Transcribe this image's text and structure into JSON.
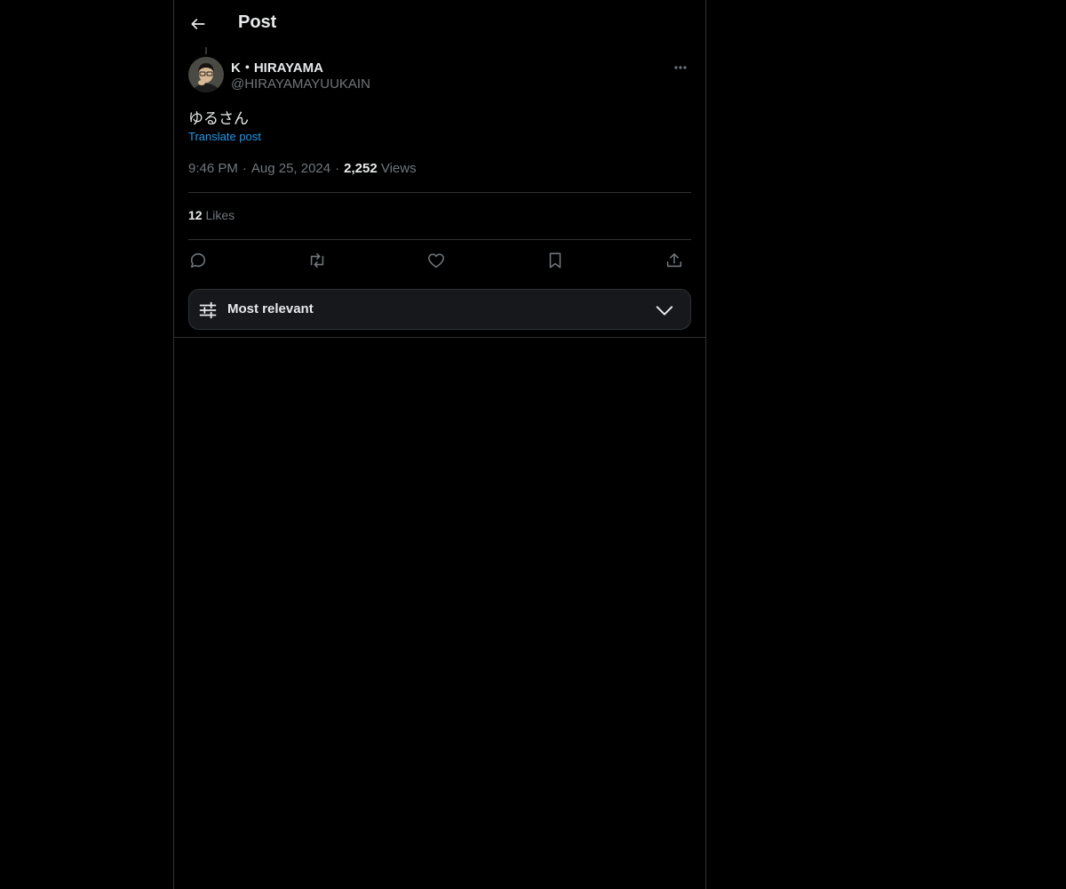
{
  "header": {
    "title": "Post",
    "back_icon": "arrow-left-icon"
  },
  "post": {
    "author": {
      "name": "K・HIRAYAMA",
      "handle": "@HIRAYAMAYUUKAIN"
    },
    "text": "ゆるさん",
    "translate_label": "Translate post",
    "time": "9:46 PM",
    "separator": "·",
    "date": "Aug 25, 2024",
    "views_count": "2,252",
    "views_label": "Views",
    "likes_count": "12",
    "likes_label": "Likes"
  },
  "actions": {
    "icons": [
      "reply-icon",
      "repost-icon",
      "like-icon",
      "bookmark-icon",
      "share-icon"
    ]
  },
  "sort": {
    "label": "Most relevant",
    "icon": "sliders-icon"
  },
  "colors": {
    "background": "#000000",
    "text": "#e7e9ea",
    "muted": "#71767b",
    "link": "#1d9bf0",
    "border": "#2f3336"
  }
}
